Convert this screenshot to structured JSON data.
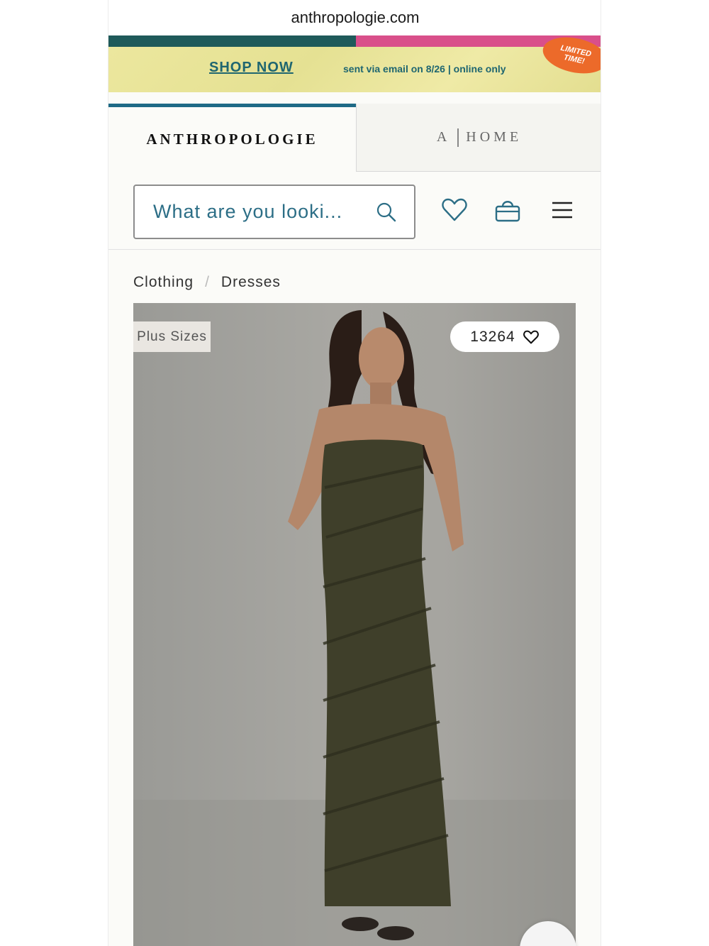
{
  "browser": {
    "url": "anthropologie.com"
  },
  "promo": {
    "cta": "SHOP NOW",
    "note": "sent via email on 8/26 | online only",
    "badge_line1": "LIMITED",
    "badge_line2": "TIME!"
  },
  "brand_tabs": [
    {
      "label": "ANTHROPOLOGIE",
      "active": true
    },
    {
      "label_a": "A",
      "label_home": "HOME",
      "active": false
    }
  ],
  "header": {
    "search_placeholder": "What are you looki...",
    "icons": [
      "search-icon",
      "heart-icon",
      "shopping-bag-icon",
      "hamburger-menu-icon"
    ]
  },
  "breadcrumb": {
    "items": [
      "Clothing",
      "Dresses"
    ],
    "separator": "/"
  },
  "product": {
    "badge": "Plus Sizes",
    "favorites_count": "13264",
    "dress_color": "#3f3f2a"
  },
  "colors": {
    "accent": "#1f6a86",
    "promo_bg": "#e9e59a",
    "badge": "#ec6a2a"
  }
}
